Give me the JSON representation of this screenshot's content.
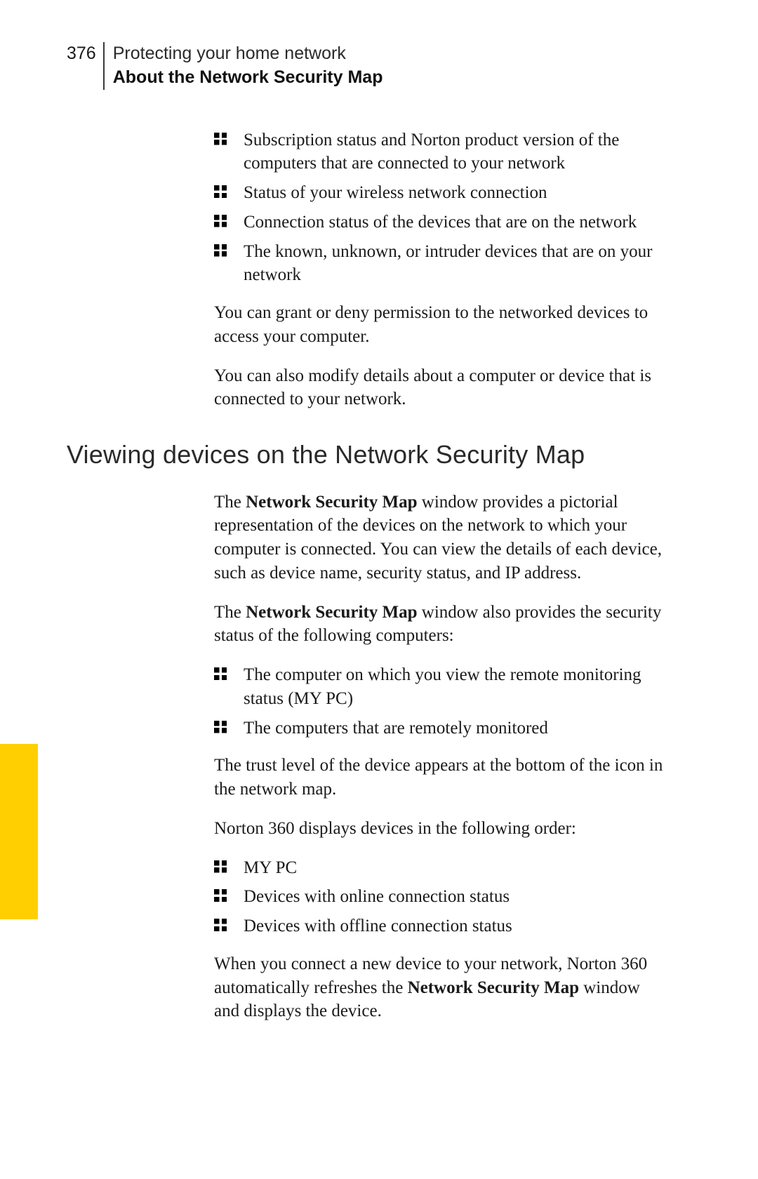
{
  "header": {
    "page_number": "376",
    "chapter_title": "Protecting your home network",
    "section_title": "About the Network Security Map"
  },
  "intro_list": [
    "Subscription status and Norton product version of the computers that are connected to your network",
    "Status of your wireless network connection",
    "Connection status of the devices that are on the network",
    "The known, unknown, or intruder devices that are on your network"
  ],
  "intro_paras": [
    "You can grant or deny permission to the networked devices to access your computer.",
    "You can also modify details about a computer or device that is connected to your network."
  ],
  "subheading": "Viewing devices on the Network Security Map",
  "p1": {
    "pre": "The ",
    "bold": "Network Security Map",
    "post": " window provides a pictorial representation of the devices on the network to which your computer is connected. You can view the details of each device, such as device name, security status, and IP address."
  },
  "p2": {
    "pre": "The ",
    "bold": "Network Security Map",
    "post": " window also provides the security status of the following computers:"
  },
  "list2": [
    "The computer on which you view the remote monitoring status (MY PC)",
    "The computers that are remotely monitored"
  ],
  "p3": "The trust level of the device appears at the bottom of the icon in the network map.",
  "p4": "Norton 360 displays devices in the following order:",
  "list3": [
    "MY PC",
    "Devices with online connection status",
    "Devices with offline connection status"
  ],
  "p5": {
    "pre": "When you connect a new device to your network, Norton 360 automatically refreshes the ",
    "bold": "Network Security Map",
    "post": " window and displays the device."
  },
  "accent_color": "#ffcf02"
}
